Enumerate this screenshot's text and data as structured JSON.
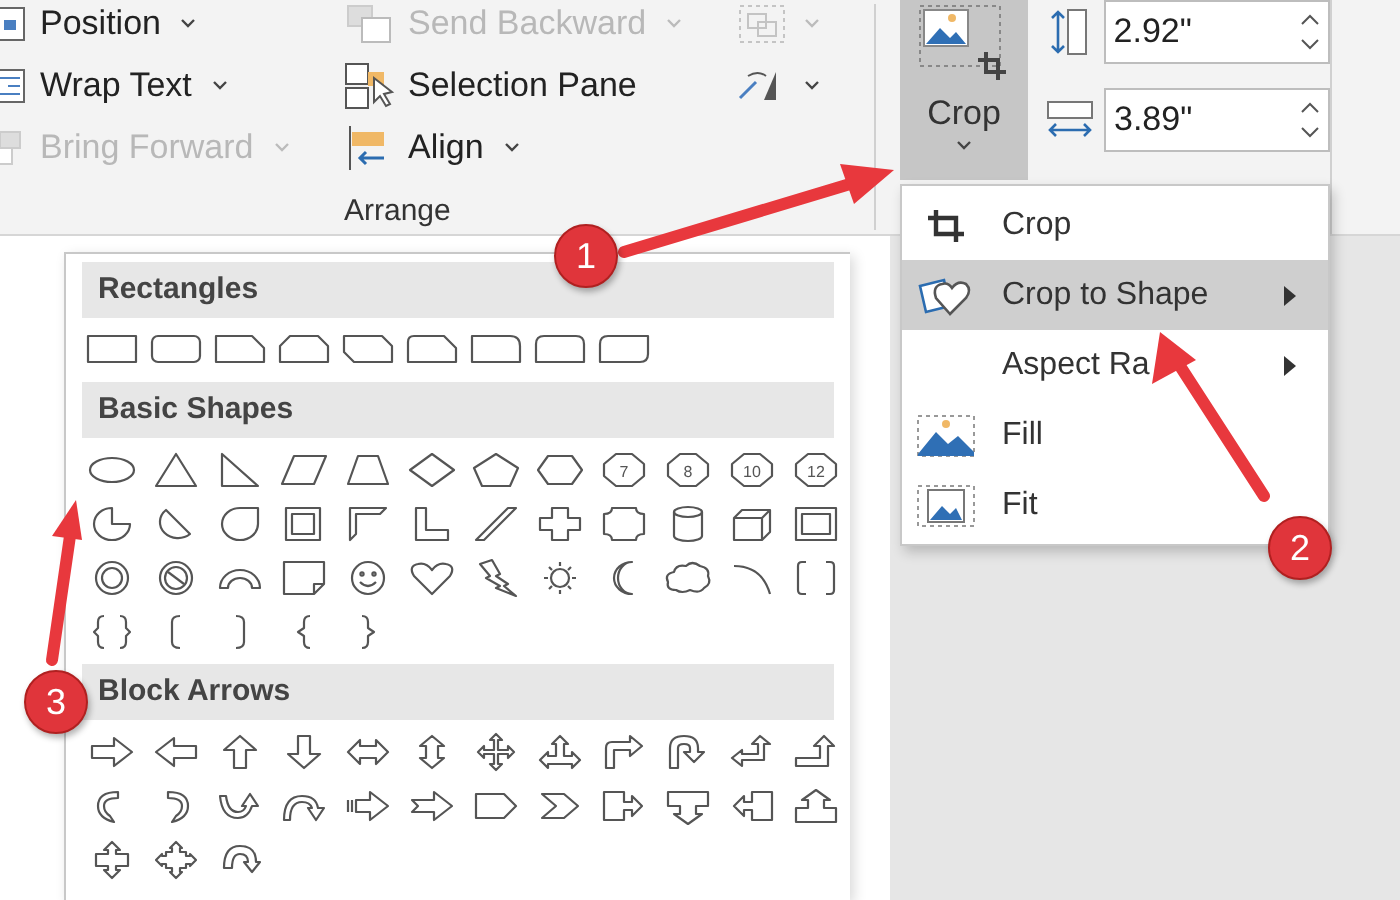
{
  "ribbon": {
    "arrange_group": {
      "label": "Arrange",
      "buttons": [
        {
          "label": "Position",
          "disabled": false,
          "dropdown": true
        },
        {
          "label": "Send Backward",
          "disabled": true,
          "dropdown": true
        },
        {
          "label": "Wrap Text",
          "disabled": false,
          "dropdown": true
        },
        {
          "label": "Selection Pane",
          "disabled": false,
          "dropdown": false
        },
        {
          "label": "Bring Forward",
          "disabled": true,
          "dropdown": true
        },
        {
          "label": "Align",
          "disabled": false,
          "dropdown": true
        }
      ],
      "icon_buttons": [
        {
          "kind": "group",
          "disabled": true
        },
        {
          "kind": "rotate",
          "disabled": false
        }
      ]
    },
    "crop_button": {
      "label": "Crop",
      "selected": true
    },
    "size_fields": [
      {
        "kind": "height",
        "value": "2.92\""
      },
      {
        "kind": "width",
        "value": "3.89\""
      }
    ]
  },
  "crop_menu": {
    "items": [
      {
        "kind": "crop",
        "label": "Crop",
        "selected": false,
        "submenu": false
      },
      {
        "kind": "shape",
        "label": "Crop to Shape",
        "selected": true,
        "submenu": true
      },
      {
        "kind": "aspect",
        "label": "Aspect Ra",
        "selected": false,
        "submenu": true
      },
      {
        "kind": "fill",
        "label": "Fill",
        "selected": false,
        "submenu": false
      },
      {
        "kind": "fit",
        "label": "Fit",
        "selected": false,
        "submenu": false
      }
    ]
  },
  "shape_gallery": {
    "sections": [
      {
        "title": "Rectangles"
      },
      {
        "title": "Basic Shapes",
        "shape_numbers": [
          "7",
          "8",
          "10",
          "12"
        ]
      },
      {
        "title": "Block Arrows"
      }
    ]
  },
  "callouts": [
    {
      "number": "1"
    },
    {
      "number": "2"
    },
    {
      "number": "3"
    }
  ]
}
